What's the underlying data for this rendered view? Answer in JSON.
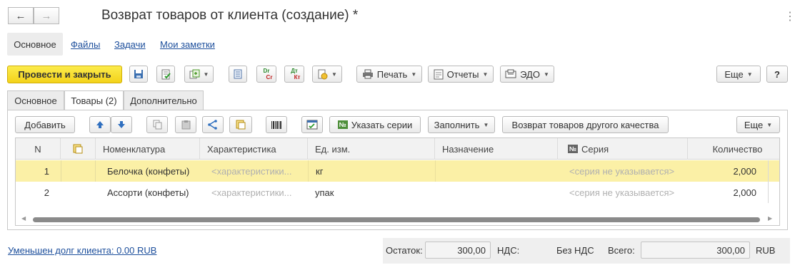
{
  "window": {
    "title": "Возврат товаров от клиента (создание) *",
    "back_icon": "←",
    "forward_icon": "→",
    "more_icon": "⋮"
  },
  "subnav": [
    "Основное",
    "Файлы",
    "Задачи",
    "Мои заметки"
  ],
  "toolbar": {
    "post_close": "Провести и закрыть",
    "print": "Печать",
    "reports": "Отчеты",
    "edo": "ЭДО",
    "more": "Еще",
    "help": "?",
    "dtkt_top": "Dr",
    "dtkt_bottom": "Cr",
    "dtkt2_top": "Дт",
    "dtkt2_bottom": "Кт"
  },
  "tabs": [
    "Основное",
    "Товары (2)",
    "Дополнительно"
  ],
  "table_toolbar": {
    "add": "Добавить",
    "specify_series": "Указать серии",
    "series_badge": "№",
    "fill": "Заполнить",
    "return_other_quality": "Возврат товаров другого качества",
    "more": "Еще"
  },
  "table": {
    "columns": [
      "N",
      "",
      "Номенклатура",
      "Характеристика",
      "Ед. изм.",
      "Назначение",
      "Серия",
      "Количество"
    ],
    "series_col_badge": "№",
    "rows": [
      {
        "n": "1",
        "item": "Белочка (конфеты)",
        "char": "<характеристики...",
        "unit": "кг",
        "purpose": "",
        "series": "<серия не указывается>",
        "qty": "2,000",
        "selected": true
      },
      {
        "n": "2",
        "item": "Ассорти (конфеты)",
        "char": "<характеристики...",
        "unit": "упак",
        "purpose": "",
        "series": "<серия не указывается>",
        "qty": "2,000",
        "selected": false
      }
    ]
  },
  "footer": {
    "debt_link": "Уменьшен долг клиента: 0.00 RUB",
    "balance_label": "Остаток:",
    "balance_value": "300,00",
    "vat_label": "НДС:",
    "vat_value": "Без НДС",
    "total_label": "Всего:",
    "total_value": "300,00",
    "currency": "RUB"
  },
  "colors": {
    "primary": "#f5d51e",
    "selected_row": "#fbf0a6",
    "link": "#1d4f9c"
  }
}
